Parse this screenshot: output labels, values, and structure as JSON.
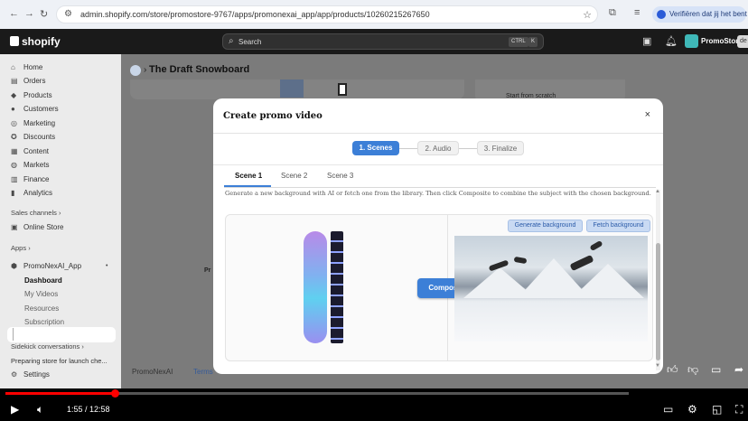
{
  "browser": {
    "url": "admin.shopify.com/store/promostore-9767/apps/promonexai_app/app/products/10260215267650",
    "verify_text": "Verifiëren dat jij het bent"
  },
  "topbar": {
    "logo": "shopify",
    "search_placeholder": "Search",
    "kbd1": "CTRL",
    "kbd2": "K",
    "store_name": "PromoStore",
    "store_chip": "de"
  },
  "sidebar": {
    "main": [
      {
        "label": "Home",
        "icon": "home-icon"
      },
      {
        "label": "Orders",
        "icon": "orders-icon"
      },
      {
        "label": "Products",
        "icon": "tag-icon"
      },
      {
        "label": "Customers",
        "icon": "person-icon"
      },
      {
        "label": "Marketing",
        "icon": "target-icon"
      },
      {
        "label": "Discounts",
        "icon": "discount-icon"
      },
      {
        "label": "Content",
        "icon": "content-icon"
      },
      {
        "label": "Markets",
        "icon": "globe-icon"
      },
      {
        "label": "Finance",
        "icon": "bank-icon"
      },
      {
        "label": "Analytics",
        "icon": "chart-icon"
      }
    ],
    "sales_channels_heading": "Sales channels",
    "online_store": "Online Store",
    "apps_heading": "Apps",
    "app_name": "PromoNexAI_App",
    "app_sub": [
      "Dashboard",
      "My Videos",
      "Resources",
      "Subscription"
    ],
    "sidekick_heading": "Sidekick conversations",
    "sidekick_item": "Preparing store for launch che...",
    "settings": "Settings"
  },
  "page": {
    "title": "The Draft Snowboard",
    "right_card_text": "Start from scratch",
    "bg_partial": "Pr",
    "footer_left": "PromoNexAI",
    "footer_link": "Terms"
  },
  "modal": {
    "title": "Create promo video",
    "close": "×",
    "steps": [
      "1. Scenes",
      "2. Audio",
      "3. Finalize"
    ],
    "tabs": [
      "Scene 1",
      "Scene 2",
      "Scene 3"
    ],
    "description": "Generate a new background with AI or fetch one from the library. Then click Composite to combine the subject with the chosen background.",
    "composite_label": "Composite",
    "generate_label": "Generate background",
    "fetch_label": "Fetch background"
  },
  "player": {
    "time": "1:55 / 12:58",
    "progress": 0.176
  },
  "colors": {
    "accent": "#3c7fd7",
    "progress": "#ff0000"
  }
}
